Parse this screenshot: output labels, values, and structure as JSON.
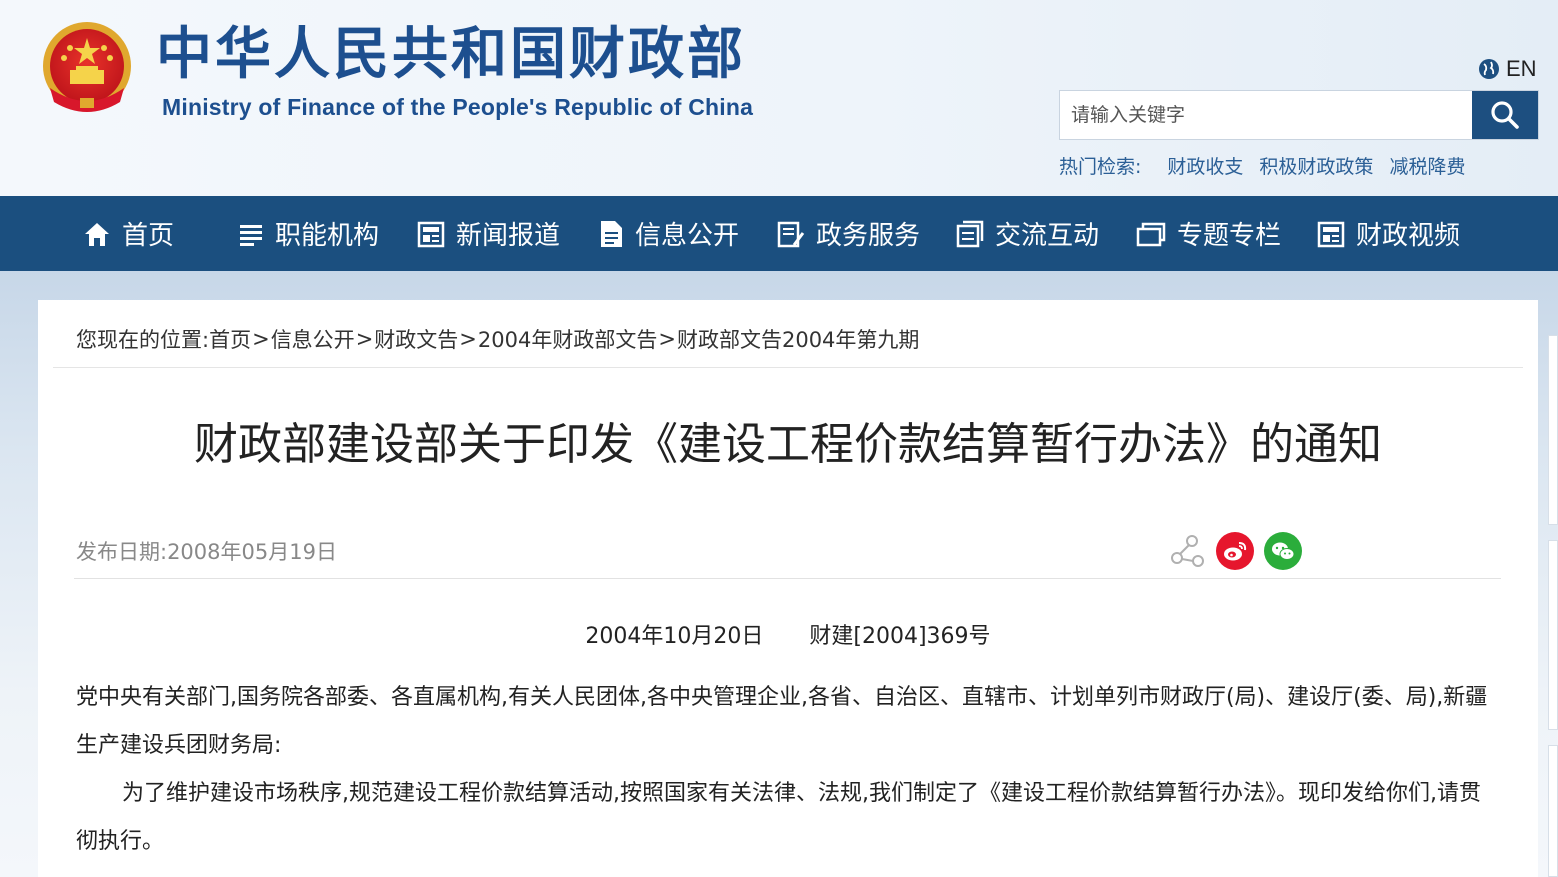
{
  "header": {
    "site_title": "中华人民共和国财政部",
    "site_subtitle": "Ministry of Finance of the People's Republic of China",
    "lang_label": "EN",
    "search": {
      "placeholder": "请输入关键字"
    },
    "hot": {
      "label": "热门检索:",
      "items": [
        "财政收支",
        "积极财政政策",
        "减税降费"
      ]
    }
  },
  "nav": {
    "items": [
      {
        "label": "首页",
        "icon": "home-icon"
      },
      {
        "label": "职能机构",
        "icon": "list-icon"
      },
      {
        "label": "新闻报道",
        "icon": "news-icon"
      },
      {
        "label": "信息公开",
        "icon": "document-icon"
      },
      {
        "label": "政务服务",
        "icon": "service-icon"
      },
      {
        "label": "交流互动",
        "icon": "interaction-icon"
      },
      {
        "label": "专题专栏",
        "icon": "topic-icon"
      },
      {
        "label": "财政视频",
        "icon": "video-icon"
      }
    ]
  },
  "breadcrumb": {
    "prefix": "您现在的位置:",
    "items": [
      "首页",
      "信息公开",
      "财政文告",
      "2004年财政部文告",
      "财政部文告2004年第九期"
    ],
    "separator": ">"
  },
  "article": {
    "title": "财政部建设部关于印发《建设工程价款结算暂行办法》的通知",
    "pubdate": "发布日期:2008年05月19日",
    "doc_date": "2004年10月20日",
    "doc_number": "财建[2004]369号",
    "para1": "党中央有关部门,国务院各部委、各直属机构,有关人民团体,各中央管理企业,各省、自治区、直辖市、计划单列市财政厅(局)、建设厅(委、局),新疆生产建设兵团财务局:",
    "para2": "为了维护建设市场秩序,规范建设工程价款结算活动,按照国家有关法律、法规,我们制定了《建设工程价款结算暂行办法》。现印发给你们,请贯彻执行。"
  },
  "share": {
    "icons": [
      "share-icon",
      "weibo-icon",
      "wechat-icon"
    ],
    "colors": {
      "weibo": "#e6162d",
      "wechat": "#2bad3b",
      "share": "#b0b0b0"
    }
  },
  "colors": {
    "brand": "#1d4f8f",
    "nav_bg": "#1b4f7f",
    "link": "#2b5f96"
  }
}
